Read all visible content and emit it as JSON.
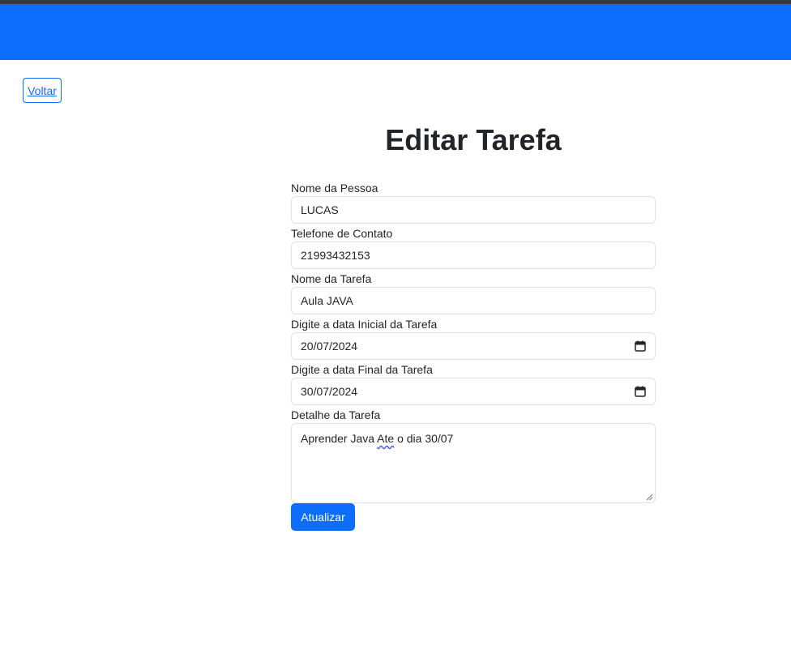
{
  "back_link": {
    "label": "Voltar"
  },
  "page_title": "Editar Tarefa",
  "form": {
    "person_name": {
      "label": "Nome da Pessoa",
      "value": "LUCAS"
    },
    "phone": {
      "label": "Telefone de Contato",
      "value": "21993432153"
    },
    "task_name": {
      "label": "Nome da Tarefa",
      "value": "Aula JAVA"
    },
    "start_date": {
      "label": "Digite a data Inicial da Tarefa",
      "value": "20/07/2024",
      "icon": "calendar-icon"
    },
    "end_date": {
      "label": "Digite a data Final da Tarefa",
      "value": "30/07/2024",
      "icon": "calendar-icon"
    },
    "details": {
      "label": "Detalhe da Tarefa",
      "prefix": "Aprender Java ",
      "flagged_word": "Ate",
      "suffix": " o dia 30/07"
    },
    "submit_label": "Atualizar"
  },
  "colors": {
    "primary": "#0d6efd",
    "text": "#212529",
    "border": "#dee2e6"
  }
}
